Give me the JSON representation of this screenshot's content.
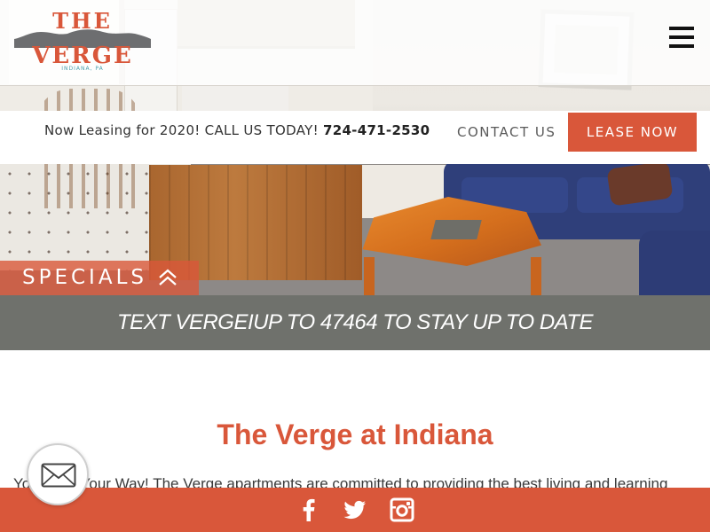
{
  "brand": {
    "logo_top": "THE",
    "logo_main": "VERGE",
    "logo_location": "INDIANA, PA"
  },
  "colors": {
    "accent": "#d9573a",
    "banner_gray": "#6f716c",
    "text": "#333333",
    "logo_location": "#4a9fae"
  },
  "header": {
    "menu_icon": "hamburger-menu-icon"
  },
  "infobar": {
    "leasing_text": "Now Leasing for 2020! CALL US TODAY!",
    "phone": "724-471-2530",
    "contact_label": "CONTACT US",
    "lease_button_label": "LEASE NOW"
  },
  "specials": {
    "label": "SPECIALS",
    "icon": "double-chevron-up-icon"
  },
  "banner": {
    "text": "TEXT VERGEIUP TO 47464 TO STAY UP TO DATE"
  },
  "main": {
    "title": "The Verge at Indiana",
    "intro": "Your Life, Your Way! The Verge apartments are committed to providing the best living and learning"
  },
  "floating": {
    "mail_icon": "envelope-icon"
  },
  "social": {
    "icons": [
      "facebook-icon",
      "twitter-icon",
      "instagram-icon"
    ]
  }
}
